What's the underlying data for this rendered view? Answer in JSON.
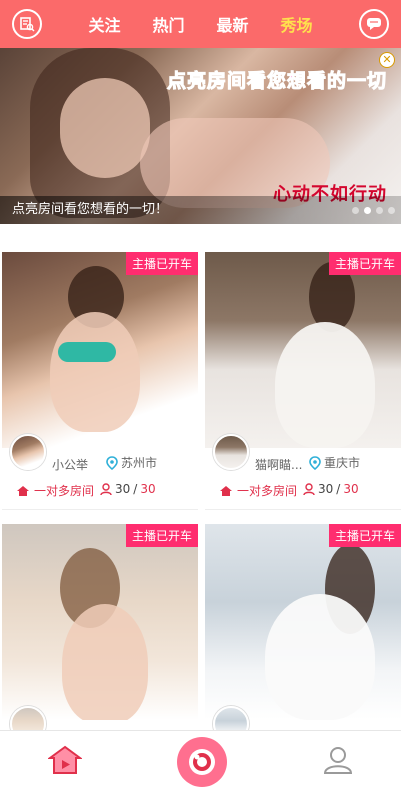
{
  "nav": {
    "tabs": [
      {
        "label": "关注",
        "active": false
      },
      {
        "label": "热门",
        "active": false
      },
      {
        "label": "最新",
        "active": false
      },
      {
        "label": "秀场",
        "active": true
      }
    ],
    "left_icon": "search-list-icon",
    "right_icon": "chat-bubble-icon",
    "colors": {
      "bar": "#fb6a6a",
      "active": "#ffe14d"
    }
  },
  "banner": {
    "slogan": "点亮房间看您想看的一切",
    "cta": "心动不如行动",
    "caption": "点亮房间看您想看的一切！",
    "slide_count": 4,
    "active_slide": 2
  },
  "cards": [
    {
      "badge": "主播已开车",
      "name": "小公举",
      "city": "苏州市",
      "room": "一对多房间",
      "count_current": "30",
      "count_max": "30"
    },
    {
      "badge": "主播已开车",
      "name": "猫啊瞄...",
      "city": "重庆市",
      "room": "一对多房间",
      "count_current": "30",
      "count_max": "30"
    },
    {
      "badge": "主播已开车",
      "name": "",
      "city": "",
      "room": "",
      "count_current": "",
      "count_max": ""
    },
    {
      "badge": "主播已开车",
      "name": "",
      "city": "",
      "room": "",
      "count_current": "",
      "count_max": ""
    }
  ],
  "bottom_nav": {
    "items": [
      "home-tv-icon",
      "live-camera-icon",
      "profile-icon"
    ],
    "accent": "#ff6f8f"
  }
}
